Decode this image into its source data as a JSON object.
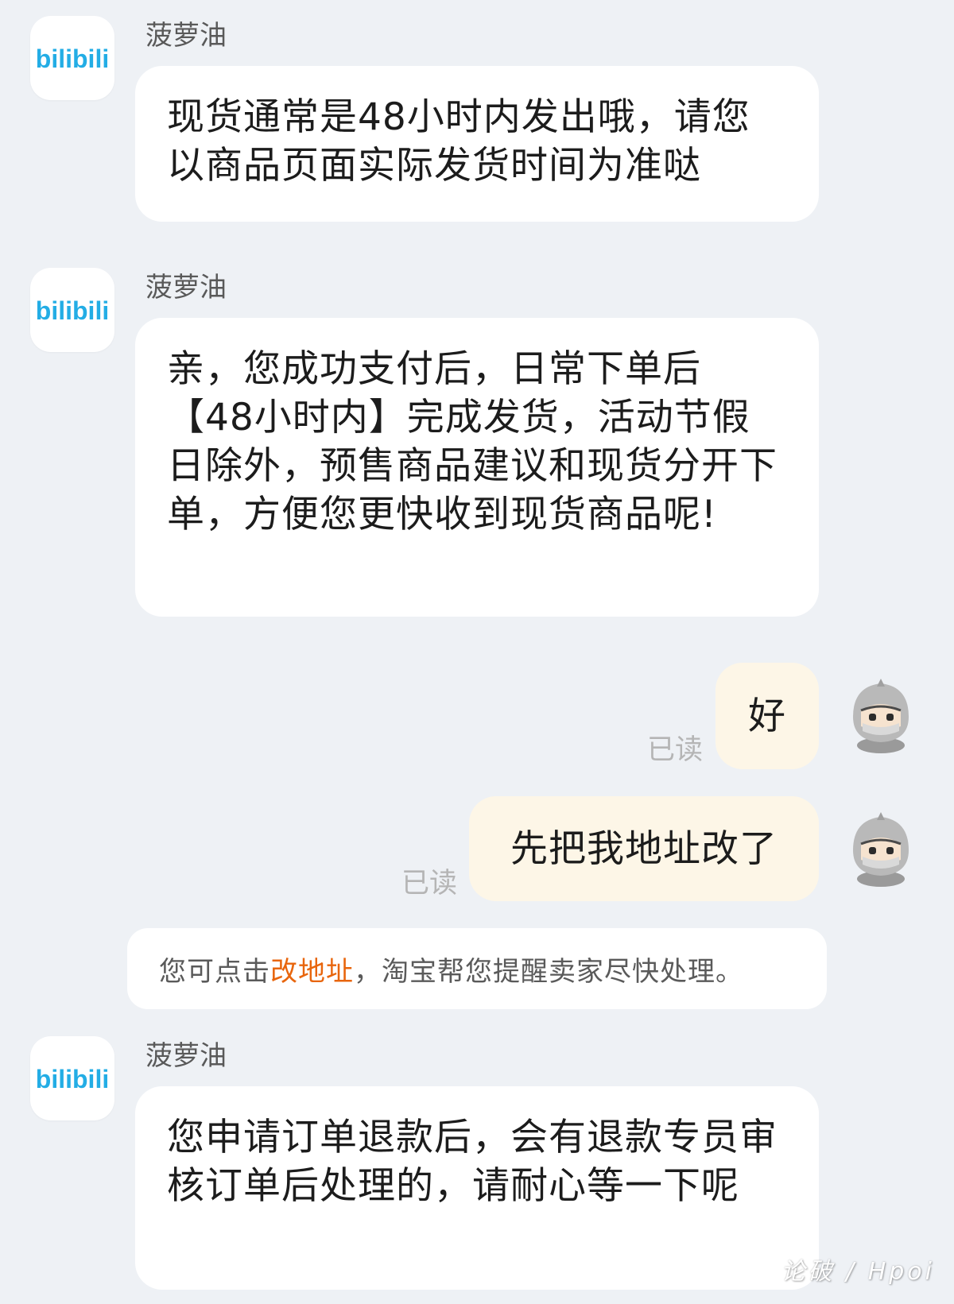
{
  "messages": [
    {
      "sender": "菠萝油",
      "text": "现货通常是48小时内发出哦，请您以商品页面实际发货时间为准哒"
    },
    {
      "sender": "菠萝油",
      "text": "亲，您成功支付后，日常下单后【48小时内】完成发货，活动节假日除外，预售商品建议和现货分开下单，方便您更快收到现货商品呢!"
    },
    {
      "text": "好",
      "status": "已读"
    },
    {
      "text": "先把我地址改了",
      "status": "已读"
    },
    {
      "sender": "菠萝油",
      "text": "您申请订单退款后，会有退款专员审核订单后处理的，请耐心等一下呢"
    }
  ],
  "system_notice": {
    "prefix": "您可点击",
    "link": "改地址",
    "suffix": "，淘宝帮您提醒卖家尽快处理。"
  },
  "shop_avatar_logo": "bilibili",
  "watermark": "论破 / Hpoi",
  "colors": {
    "background": "#eef1f5",
    "incoming_bubble": "#ffffff",
    "outgoing_bubble": "#fdf6e7",
    "link": "#e8650c",
    "brand_blue": "#23ade5"
  }
}
